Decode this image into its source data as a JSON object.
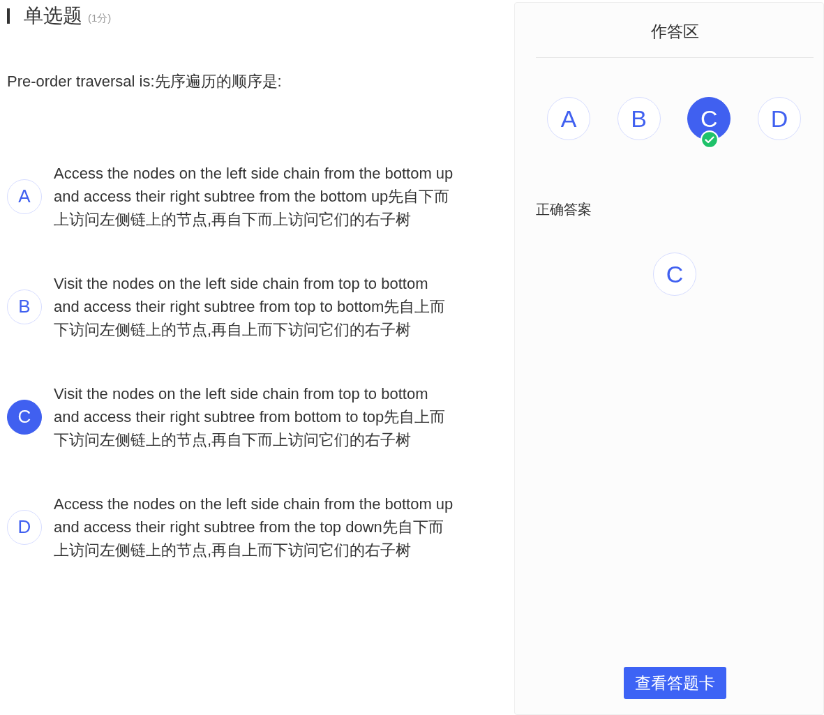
{
  "question": {
    "type": "单选题",
    "score": "(1分)",
    "text": "Pre-order traversal is:先序遍历的顺序是:"
  },
  "options": [
    {
      "letter": "A",
      "text": "Access the nodes on the left side chain from the bottom up and access their right subtree from the bottom up先自下而上访问左侧链上的节点,再自下而上访问它们的右子树",
      "selected": false
    },
    {
      "letter": "B",
      "text": "Visit the nodes on the left side chain from top to bottom and access their right subtree from top to bottom先自上而下访问左侧链上的节点,再自上而下访问它们的右子树",
      "selected": false
    },
    {
      "letter": "C",
      "text": "Visit the nodes on the left side chain from top to bottom and access their right subtree from bottom to top先自上而下访问左侧链上的节点,再自下而上访问它们的右子树",
      "selected": true
    },
    {
      "letter": "D",
      "text": "Access the nodes on the left side chain from the bottom up and access their right subtree from the top down先自下而上访问左侧链上的节点,再自上而下访问它们的右子树",
      "selected": false
    }
  ],
  "answer_panel": {
    "title": "作答区",
    "choices": [
      {
        "letter": "A",
        "selected": false,
        "correct": false
      },
      {
        "letter": "B",
        "selected": false,
        "correct": false
      },
      {
        "letter": "C",
        "selected": true,
        "correct": true
      },
      {
        "letter": "D",
        "selected": false,
        "correct": false
      }
    ],
    "correct_label": "正确答案",
    "correct_answer": "C",
    "button": "查看答题卡"
  }
}
